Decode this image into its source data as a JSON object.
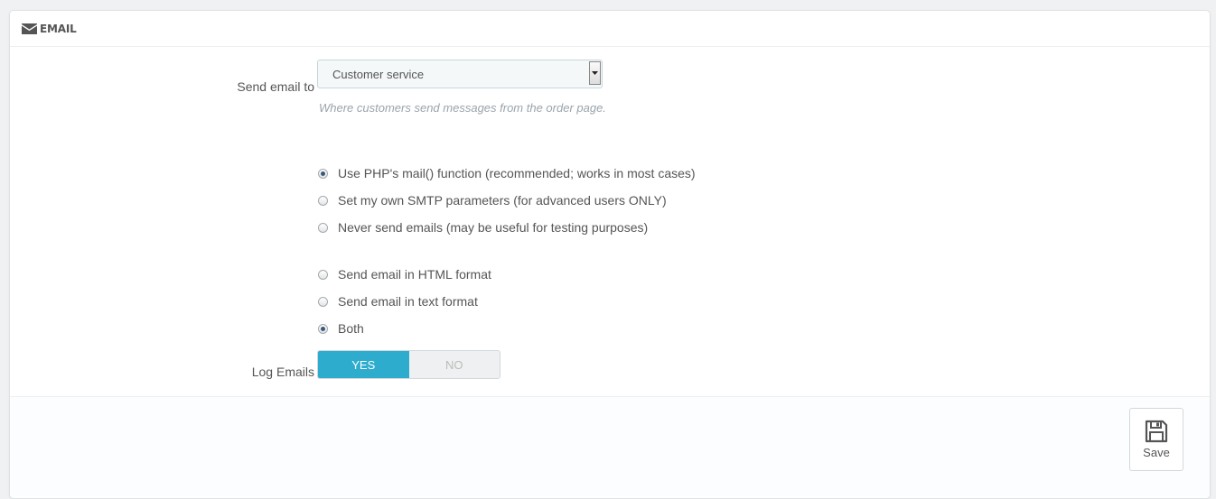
{
  "panel": {
    "title": "EMAIL",
    "icon": "envelope-icon"
  },
  "send_email_to": {
    "label": "Send email to",
    "selected": "Customer service",
    "help": "Where customers send messages from the order page."
  },
  "mail_method": {
    "options": [
      {
        "label": "Use PHP's mail() function (recommended; works in most cases)",
        "checked": true
      },
      {
        "label": "Set my own SMTP parameters (for advanced users ONLY)",
        "checked": false
      },
      {
        "label": "Never send emails (may be useful for testing purposes)",
        "checked": false
      }
    ]
  },
  "mail_format": {
    "options": [
      {
        "label": "Send email in HTML format",
        "checked": false
      },
      {
        "label": "Send email in text format",
        "checked": false
      },
      {
        "label": "Both",
        "checked": true
      }
    ]
  },
  "log_emails": {
    "label": "Log Emails",
    "yes": "YES",
    "no": "NO",
    "value": "YES"
  },
  "footer": {
    "save_label": "Save",
    "save_icon": "floppy-disk-icon"
  },
  "colors": {
    "accent": "#2eacce",
    "help_text": "#9aa4ab"
  }
}
